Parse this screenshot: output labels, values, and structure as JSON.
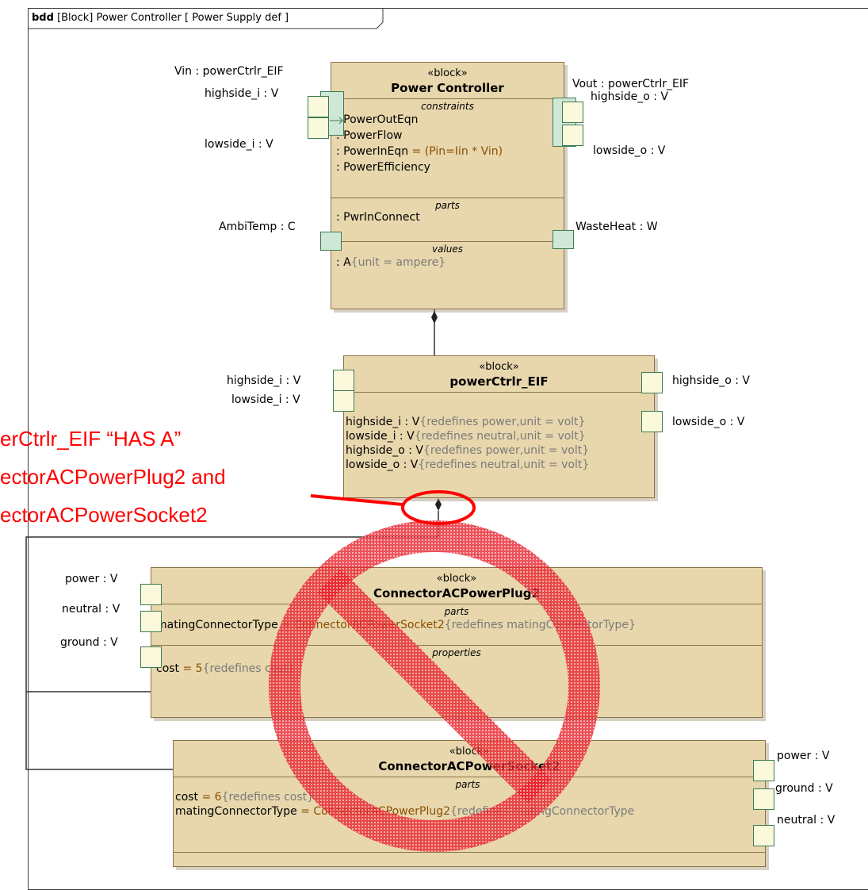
{
  "frame": {
    "kind": "bdd",
    "title": "[Block] Power Controller [ Power Supply def ]"
  },
  "power_controller": {
    "stereotype": "«block»",
    "name": "Power Controller",
    "constraints_title": "constraints",
    "constraints": [
      ": PowerOutEqn",
      ": PowerFlow",
      ": PowerInEqn",
      ": PowerEfficiency"
    ],
    "constraint_expr": " = (Pin=Iin * Vin)",
    "parts_title": "parts",
    "parts": [
      ": PwrInConnect"
    ],
    "values_title": "values",
    "values": [
      ": A",
      "{unit = ampere}"
    ],
    "ports": {
      "vin": "Vin : powerCtrlr_EIF",
      "highside_i": "highside_i : V",
      "lowside_i": "lowside_i : V",
      "vout": "Vout : powerCtrlr_EIF",
      "highside_o": "highside_o : V",
      "lowside_o": "lowside_o : V",
      "ambi": "AmbiTemp : C",
      "waste": "WasteHeat : W"
    }
  },
  "eif": {
    "stereotype": "«block»",
    "name": "powerCtrlr_EIF",
    "rows": [
      {
        "name": "highside_i",
        "type": " : V",
        "mod": "{redefines power,unit = volt}"
      },
      {
        "name": "lowside_i",
        "type": " : V",
        "mod": "{redefines neutral,unit = volt}"
      },
      {
        "name": "highside_o",
        "type": " : V",
        "mod": "{redefines power,unit = volt}"
      },
      {
        "name": "lowside_o",
        "type": " : V",
        "mod": "{redefines neutral,unit = volt}"
      }
    ],
    "ports": {
      "highside_i": "highside_i : V",
      "lowside_i": "lowside_i : V",
      "highside_o": "highside_o : V",
      "lowside_o": "lowside_o : V"
    }
  },
  "plug": {
    "stereotype": "«block»",
    "name": "ConnectorACPowerPlug2",
    "parts_title": "parts",
    "part_name": "matingConnectorType",
    "part_value": " = ConnectorACPowerSocket2",
    "part_mod": "{redefines matingConnectorType}",
    "properties_title": "properties",
    "prop_name": "cost",
    "prop_value": " = 5",
    "prop_mod": "{redefines cost}",
    "ports": {
      "power": "power : V",
      "neutral": "neutral : V",
      "ground": "ground : V"
    }
  },
  "socket": {
    "stereotype": "«block»",
    "name": "ConnectorACPowerSocket2",
    "parts_title": "parts",
    "cost_name": "cost",
    "cost_value": " = 6",
    "cost_mod": "{redefines cost}",
    "mct_name": "matingConnectorType",
    "mct_value": " = ConnectorACPowerPlug2",
    "mct_mod": "{redefines matingConnectorType",
    "ports": {
      "power": "power : V",
      "ground": "ground : V",
      "neutral": "neutral : V"
    }
  },
  "annotation": {
    "line1": "erCtrlr_EIF “HAS A”",
    "line2": "ectorACPowerPlug2 and",
    "line3": "ectorACPowerSocket2"
  },
  "colors": {
    "block_fill": "#e8d7ad",
    "annotation": "#ff0000",
    "prohibition": "#e8202a"
  }
}
